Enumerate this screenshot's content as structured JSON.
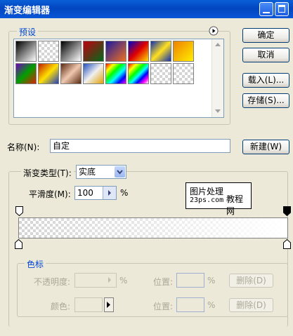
{
  "window": {
    "title": "渐变编辑器"
  },
  "presets": {
    "label": "预设"
  },
  "buttons": {
    "ok": "确定",
    "cancel": "取消",
    "load": "载入(L)...",
    "save": "存储(S)...",
    "new": "新建(W)"
  },
  "name": {
    "label": "名称(N):",
    "value": "自定"
  },
  "gradient": {
    "type_label": "渐变类型(T):",
    "type_value": "实底",
    "smoothness_label": "平滑度(M):",
    "smoothness_value": "100",
    "smoothness_unit": "%"
  },
  "watermark": {
    "line1": "图片处理",
    "line2": "23ps.com",
    "line3": "教程网"
  },
  "stops": {
    "label": "色标",
    "opacity_label": "不透明度:",
    "opacity_unit": "%",
    "location_label": "位置:",
    "location_unit": "%",
    "delete_label": "删除(D)",
    "color_label": "颜色:"
  },
  "colors": {
    "accent": "#0046d5",
    "titlebar": "#0246c0"
  }
}
